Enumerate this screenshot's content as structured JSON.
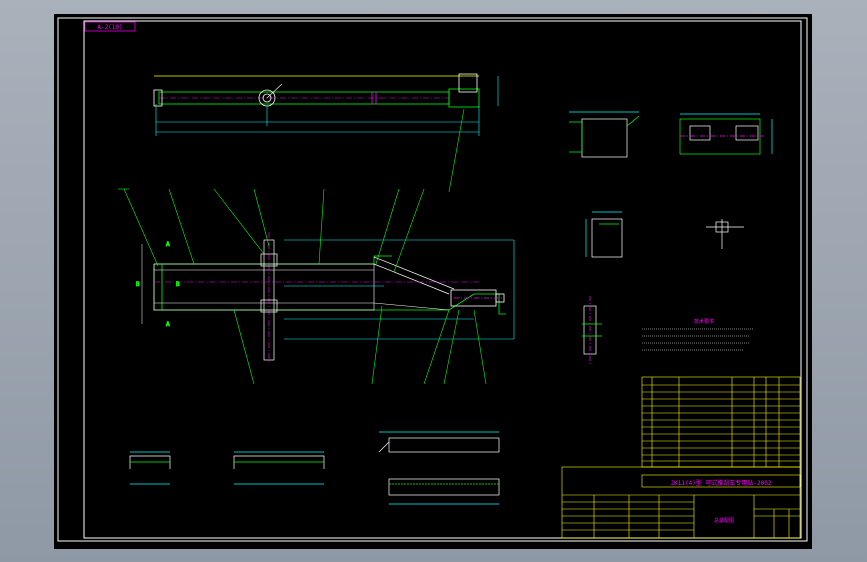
{
  "drawing": {
    "tag_text": "A-2(10)",
    "title_block": {
      "model_title": "JK11(4)型 可式推刮车专用钻-2002",
      "section_label": "总装配图"
    },
    "notes": {
      "heading": "技术要求"
    }
  },
  "colors": {
    "background": "#000000",
    "frame": "#ffffff",
    "border": "#ffff00",
    "geometry": "#00ff00",
    "dimension": "#00ffff",
    "text": "#ff00ff",
    "center": "#ff3cff"
  }
}
